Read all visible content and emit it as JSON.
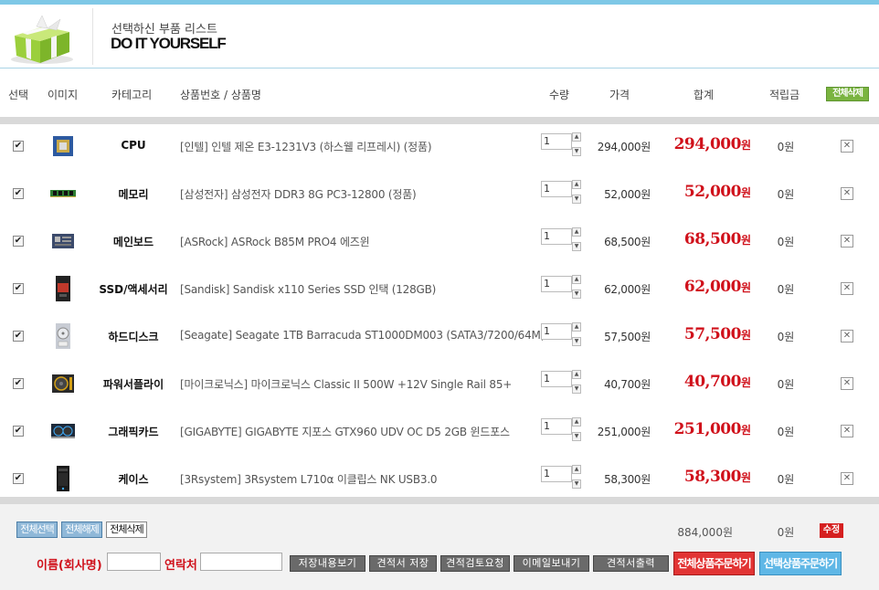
{
  "header": {
    "subtitle": "선택하신 부품 리스트",
    "title": "DO IT YOURSELF"
  },
  "columns": {
    "select": "선택",
    "image": "이미지",
    "category": "카테고리",
    "product": "상품번호 / 상품명",
    "qty": "수량",
    "price": "가격",
    "total": "합계",
    "points": "적립금",
    "delete_all": "전체삭제"
  },
  "items": [
    {
      "category": "CPU",
      "name": "[인텔] 인텔 제온 E3-1231V3 (하스웰 리프레시) (정품)",
      "qty": "1",
      "price": "294,000원",
      "total": "294,000",
      "won": "원",
      "points": "0원",
      "thumb": "cpu-icon"
    },
    {
      "category": "메모리",
      "name": "[삼성전자] 삼성전자 DDR3 8G PC3-12800 (정품)",
      "qty": "1",
      "price": "52,000원",
      "total": "52,000",
      "won": "원",
      "points": "0원",
      "thumb": "ram-icon"
    },
    {
      "category": "메인보드",
      "name": "[ASRock] ASRock B85M PRO4 에즈윈",
      "qty": "1",
      "price": "68,500원",
      "total": "68,500",
      "won": "원",
      "points": "0원",
      "thumb": "motherboard-icon"
    },
    {
      "category": "SSD/액세서리",
      "name": "[Sandisk] Sandisk x110 Series SSD 인택 (128GB)",
      "qty": "1",
      "price": "62,000원",
      "total": "62,000",
      "won": "원",
      "points": "0원",
      "thumb": "ssd-icon"
    },
    {
      "category": "하드디스크",
      "name": "[Seagate] Seagate 1TB Barracuda ST1000DM003 (SATA3/7200/64M)",
      "qty": "1",
      "price": "57,500원",
      "total": "57,500",
      "won": "원",
      "points": "0원",
      "thumb": "hdd-icon"
    },
    {
      "category": "파워서플라이",
      "name": "[마이크로닉스] 마이크로닉스 Classic II 500W +12V Single Rail 85+",
      "qty": "1",
      "price": "40,700원",
      "total": "40,700",
      "won": "원",
      "points": "0원",
      "thumb": "psu-icon"
    },
    {
      "category": "그래픽카드",
      "name": "[GIGABYTE] GIGABYTE 지포스 GTX960 UDV OC D5 2GB 윈드포스",
      "qty": "1",
      "price": "251,000원",
      "total": "251,000",
      "won": "원",
      "points": "0원",
      "thumb": "gpu-icon"
    },
    {
      "category": "케이스",
      "name": "[3Rsystem] 3Rsystem L710α 이클립스 NK USB3.0",
      "qty": "1",
      "price": "58,300원",
      "total": "58,300",
      "won": "원",
      "points": "0원",
      "thumb": "case-icon"
    }
  ],
  "footer": {
    "select_all": "전체선택",
    "deselect_all": "전체해제",
    "delete_all": "전체삭제",
    "sum_total": "884,000원",
    "sum_points": "0원",
    "edit": "수정",
    "name_label": "이름(회사명)",
    "contact_label": "연락처",
    "view_saved": "저장내용보기",
    "save_quote": "견적서 저장",
    "request_review": "견적검토요청",
    "send_email": "이메일보내기",
    "print_quote": "견적서출력",
    "order_all": "전체상품주문하기",
    "order_selected": "선택상품주문하기"
  },
  "colors": {
    "accent_blue": "#7ec8e6",
    "price_red": "#d0111b",
    "delete_green": "#7ab440"
  }
}
